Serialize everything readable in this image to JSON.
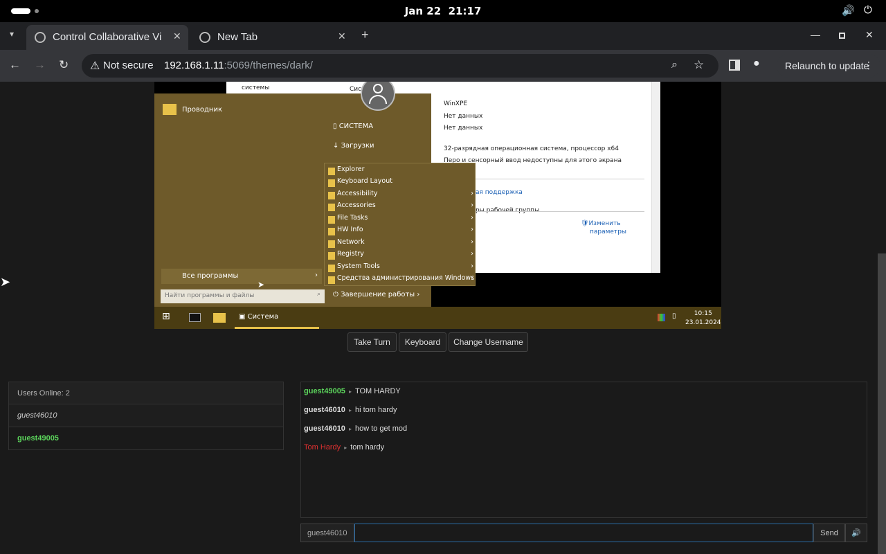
{
  "topbar": {
    "date": "Jan 22",
    "time": "21:17"
  },
  "tabs": [
    {
      "title": "Control Collaborative Vi"
    },
    {
      "title": "New Tab"
    }
  ],
  "toolbar": {
    "security": "Not secure",
    "host": "192.168.1.11",
    "path": ":5069/themes/dark/",
    "relaunch": "Relaunch to update"
  },
  "vm": {
    "syswin_lines": [
      "системы",
      "Сис",
      "WinXPE",
      "Нет данных",
      "Нет данных",
      "32-разрядная операционная система, процессор x64",
      "Перо и сенсорный ввод недоступны для этого экрана",
      "ая поддержка",
      "ры рабочей группы",
      "Изменить",
      "параметры"
    ],
    "pinned": "Проводник",
    "right_links": [
      "СИСТЕМА",
      "Загрузки"
    ],
    "all_programs": "Все программы",
    "search_placeholder": "Найти программы и файлы",
    "shutdown": "Завершение работы",
    "submenu": [
      "Explorer",
      "Keyboard Layout",
      "Accessibility",
      "Accessories",
      "File Tasks",
      "HW Info",
      "Network",
      "Registry",
      "System Tools",
      "Средства администрирования Windows"
    ],
    "taskbar_app": "Система",
    "clock_time": "10:15",
    "clock_date": "23.01.2024"
  },
  "controls": {
    "take_turn": "Take Turn",
    "keyboard": "Keyboard",
    "change_username": "Change Username"
  },
  "users": {
    "header": "Users Online: 2",
    "list": [
      {
        "name": "guest46010"
      },
      {
        "name": "guest49005"
      }
    ]
  },
  "chat": {
    "messages": [
      {
        "user": "guest49005",
        "text": "TOM HARDY",
        "color": "#5cd65c"
      },
      {
        "user": "guest46010",
        "text": "hi tom hardy",
        "color": "#dddddd"
      },
      {
        "user": "guest46010",
        "text": "how to get mod",
        "color": "#dddddd"
      },
      {
        "user": "Tom Hardy",
        "text": "tom hardy",
        "color": "#e03030"
      }
    ],
    "username": "guest46010",
    "input_value": "",
    "send": "Send"
  },
  "colors": {
    "accent_green": "#5cd65c",
    "admin_red": "#e03030",
    "input_focus": "#2a6da8"
  }
}
